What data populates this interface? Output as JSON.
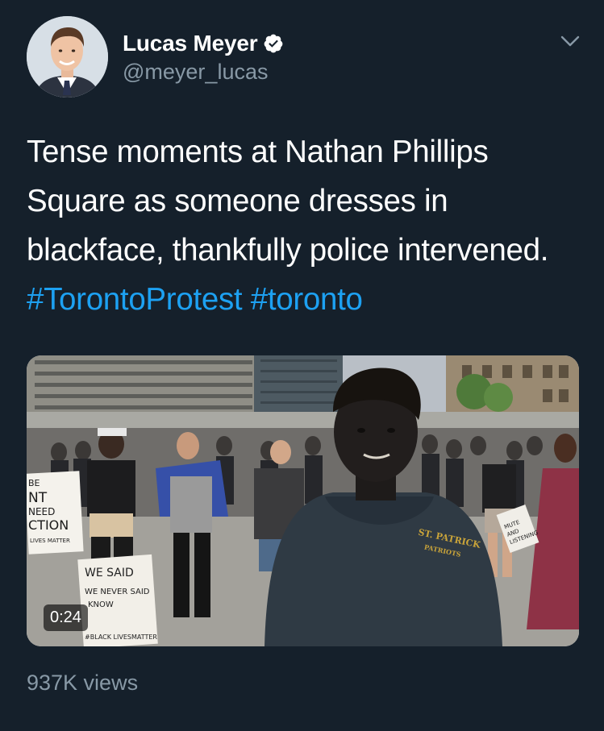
{
  "author": {
    "display_name": "Lucas Meyer",
    "handle": "@meyer_lucas",
    "verified": true,
    "avatar_icon": "avatar-photo"
  },
  "tweet": {
    "text": "Tense moments at Nathan Phillips Square as someone dresses in blackface, thankfully police intervened.",
    "hashtags": [
      "#TorontoProtest",
      "#toronto"
    ]
  },
  "media": {
    "type": "video",
    "duration": "0:24",
    "sign_left": [
      "BE",
      "NT",
      "NEED",
      "CTION",
      "LIVES MATTER"
    ],
    "sign_center": [
      "WE SAID",
      "WE NEVER SAID",
      "KNOW",
      "#BLACK LIVESMATTER"
    ],
    "sign_right": [
      "MUTE",
      "AND",
      "LISTENING"
    ],
    "shirt_text": [
      "ST. PATRICK",
      "PATRIOTS"
    ]
  },
  "stats": {
    "views": "937K views"
  },
  "colors": {
    "background": "#15202b",
    "text_primary": "#ffffff",
    "text_secondary": "#8899a6",
    "link": "#1da1f2",
    "verified_badge": "#ffffff"
  },
  "icons": {
    "verified": "verified-badge-icon",
    "menu": "chevron-down-icon"
  }
}
